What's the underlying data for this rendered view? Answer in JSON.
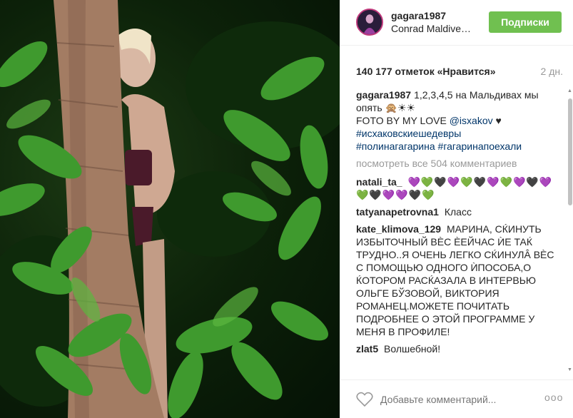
{
  "header": {
    "username": "gagara1987",
    "location": "Conrad Maldive…",
    "follow_label": "Подписки"
  },
  "stats": {
    "likes": "140 177 отметок «Нравится»",
    "time": "2 дн."
  },
  "caption": {
    "user": "gagara1987",
    "line1": "1,2,3,4,5 на Мальдивах мы опять 🙊☀☀",
    "line2_prefix": "FOTO BY MY LOVE",
    "mention": "@isxakov",
    "line2_suffix": "♥",
    "hashtag1": "#исхаковскиешедевры",
    "hashtag2": "#полинагагарина",
    "hashtag3": "#гагаринапоехали"
  },
  "view_all": "посмотреть все 504 комментариев",
  "comments": [
    {
      "user": "natali_ta_",
      "text": "💜💚🖤💜💚🖤💜💚💜🖤💜💚🖤💜💜🖤💚"
    },
    {
      "user": "tatyanapetrovna1",
      "text": "Класс"
    },
    {
      "user": "kate_klimova_129",
      "text": "МАРИНА, СЌИНУТЬ ИЗБЫТОЧНЫЙ ВЀС ЀЕЙЧАС ЍЕ ТАЌ ТРУДНО..Я ОЧЕНЬ ЛЕГКО СЌИНУЛÂ ВЀС С ПОМОЩЬЮ ОДНОГО ЍПОСОБА,О ЌОТОРОМ РАСЌАЗАЛА В ИНТЕРВЬЮ ОЛЬГЕ БЎЗОВОЙ, ВИКТОРИЯ РОМАНЕЦ.МОЖЕТЕ ПОЧИТАТЬ ПОДРОБНЕЕ О ЭТОЙ ПРОГРАММЕ У МЕНЯ В ПРОФИЛЕ!"
    },
    {
      "user": "zlat5",
      "text": "Волшебной!"
    }
  ],
  "footer": {
    "comment_placeholder": "Добавьте комментарий...",
    "more_label": "ooo"
  }
}
